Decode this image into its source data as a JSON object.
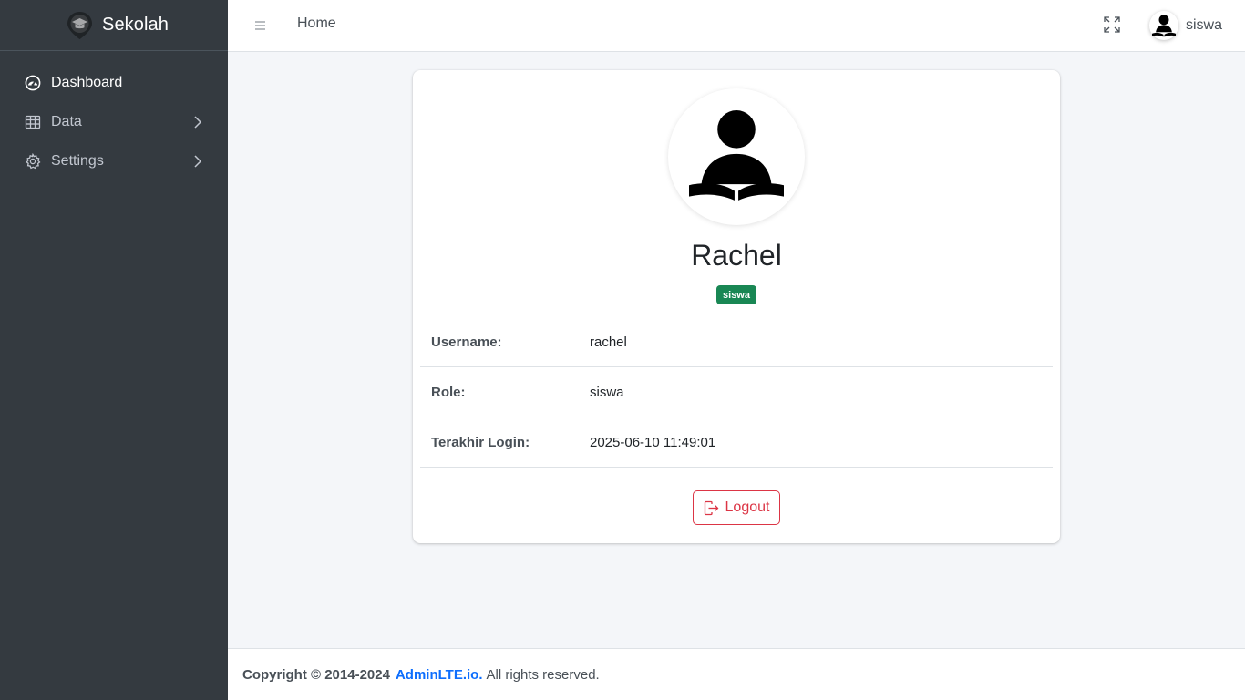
{
  "brand": {
    "name": "Sekolah",
    "logo_icon": "graduation-cap-pin-icon"
  },
  "sidebar": {
    "items": [
      {
        "label": "Dashboard",
        "icon": "speedometer-icon",
        "active": true
      },
      {
        "label": "Data",
        "icon": "table-icon",
        "has_children": true
      },
      {
        "label": "Settings",
        "icon": "gear-icon",
        "has_children": true
      }
    ]
  },
  "topbar": {
    "menu_icon": "hamburger-icon",
    "home_label": "Home",
    "fullscreen_icon": "fullscreen-icon",
    "user_name": "siswa"
  },
  "profile": {
    "name": "Rachel",
    "badge": "siswa",
    "rows": [
      {
        "label": "Username:",
        "value": "rachel"
      },
      {
        "label": "Role:",
        "value": "siswa"
      },
      {
        "label": "Terakhir Login:",
        "value": "2025-06-10 11:49:01"
      }
    ],
    "logout_label": "Logout"
  },
  "footer": {
    "copyright": "Copyright © 2014-2024",
    "link": "AdminLTE.io.",
    "rights": "All rights reserved."
  },
  "colors": {
    "sidebar_bg": "#343a40",
    "badge_bg": "#198754",
    "danger": "#dc3545",
    "link": "#0d6efd"
  }
}
